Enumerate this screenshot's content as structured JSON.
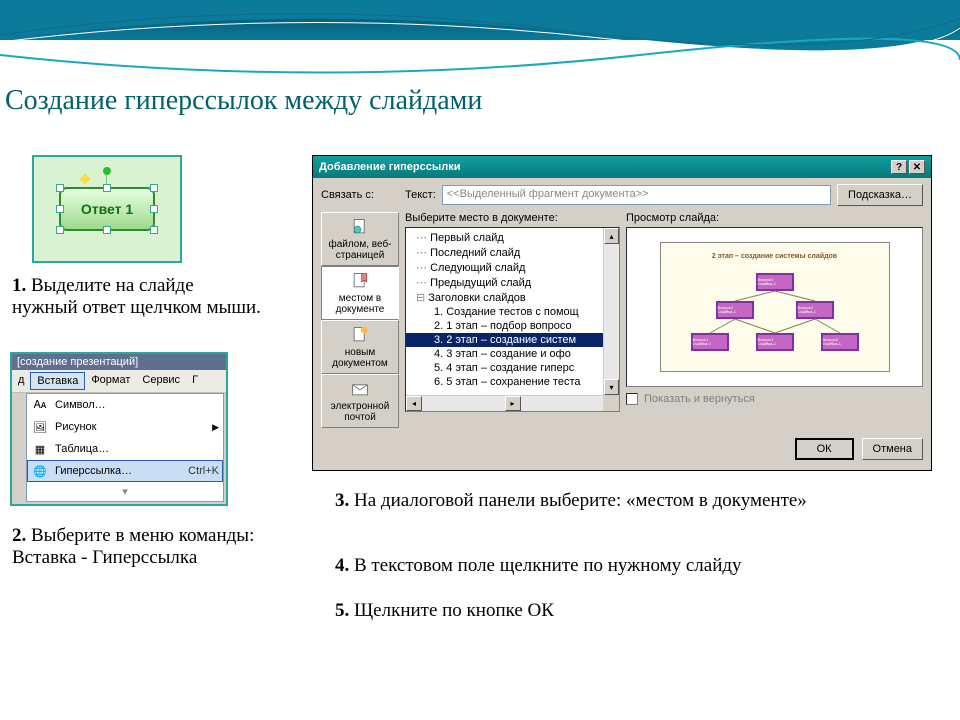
{
  "title": "Создание гиперссылок между слайдами",
  "answer_button_label": "Ответ 1",
  "steps": {
    "s1_num": "1.",
    "s1": "Выделите на слайде нужный ответ щелчком мыши.",
    "s2_num": "2.",
    "s2a": "Выберите в меню команды:",
    "s2b": "Вставка - Гиперссылка",
    "s3_num": "3.",
    "s3": "На диалоговой панели выберите: «местом в документе»",
    "s4_num": "4.",
    "s4": "В текстовом поле щелкните по нужному слайду",
    "s5_num": "5.",
    "s5": "Щелкните по кнопке ОК"
  },
  "menu": {
    "window_title": "[создание презентаций]",
    "bar": {
      "insert": "Вставка",
      "format": "Формат",
      "service": "Сервис"
    },
    "items": {
      "symbol": "Символ…",
      "picture": "Рисунок",
      "table": "Таблица…",
      "hyperlink": "Гиперссылка…",
      "shortcut": "Ctrl+K"
    }
  },
  "dialog": {
    "title": "Добавление гиперссылки",
    "link_to": "Связать с:",
    "text_label": "Текст:",
    "text_value": "<<Выделенный фрагмент документа>>",
    "tooltip_btn": "Подсказка…",
    "tabs": {
      "file": "файлом, веб-страницей",
      "place": "местом в документе",
      "new_doc": "новым документом",
      "email": "электронной почтой"
    },
    "choose_label": "Выберите место в документе:",
    "preview_label": "Просмотр слайда:",
    "tree": {
      "first": "Первый слайд",
      "last": "Последний слайд",
      "next": "Следующий слайд",
      "prev": "Предыдущий слайд",
      "headers": "Заголовки слайдов",
      "c1": "1. Создание тестов с помощ",
      "c2": "2. 1 этап – подбор вопросо",
      "c3": "3. 2 этап – создание систем",
      "c4": "4. 3 этап – создание и офо",
      "c5": "5. 4 этап – создание гиперс",
      "c6": "6. 5 этап – сохранение теста"
    },
    "preview_slide_title": "2 этап – создание системы слайдов",
    "nodes": [
      "Вопрос1 Ошибка-1",
      "Вопрос2 Ошибка-1",
      "Вопрос2 Ошибка-1",
      "Вопрос1 Ошибка-1",
      "Вопрос1 Ошибка-1",
      "Вопрос2 Ошибка-1"
    ],
    "show_return": "Показать и вернуться",
    "ok": "ОК",
    "cancel": "Отмена"
  }
}
